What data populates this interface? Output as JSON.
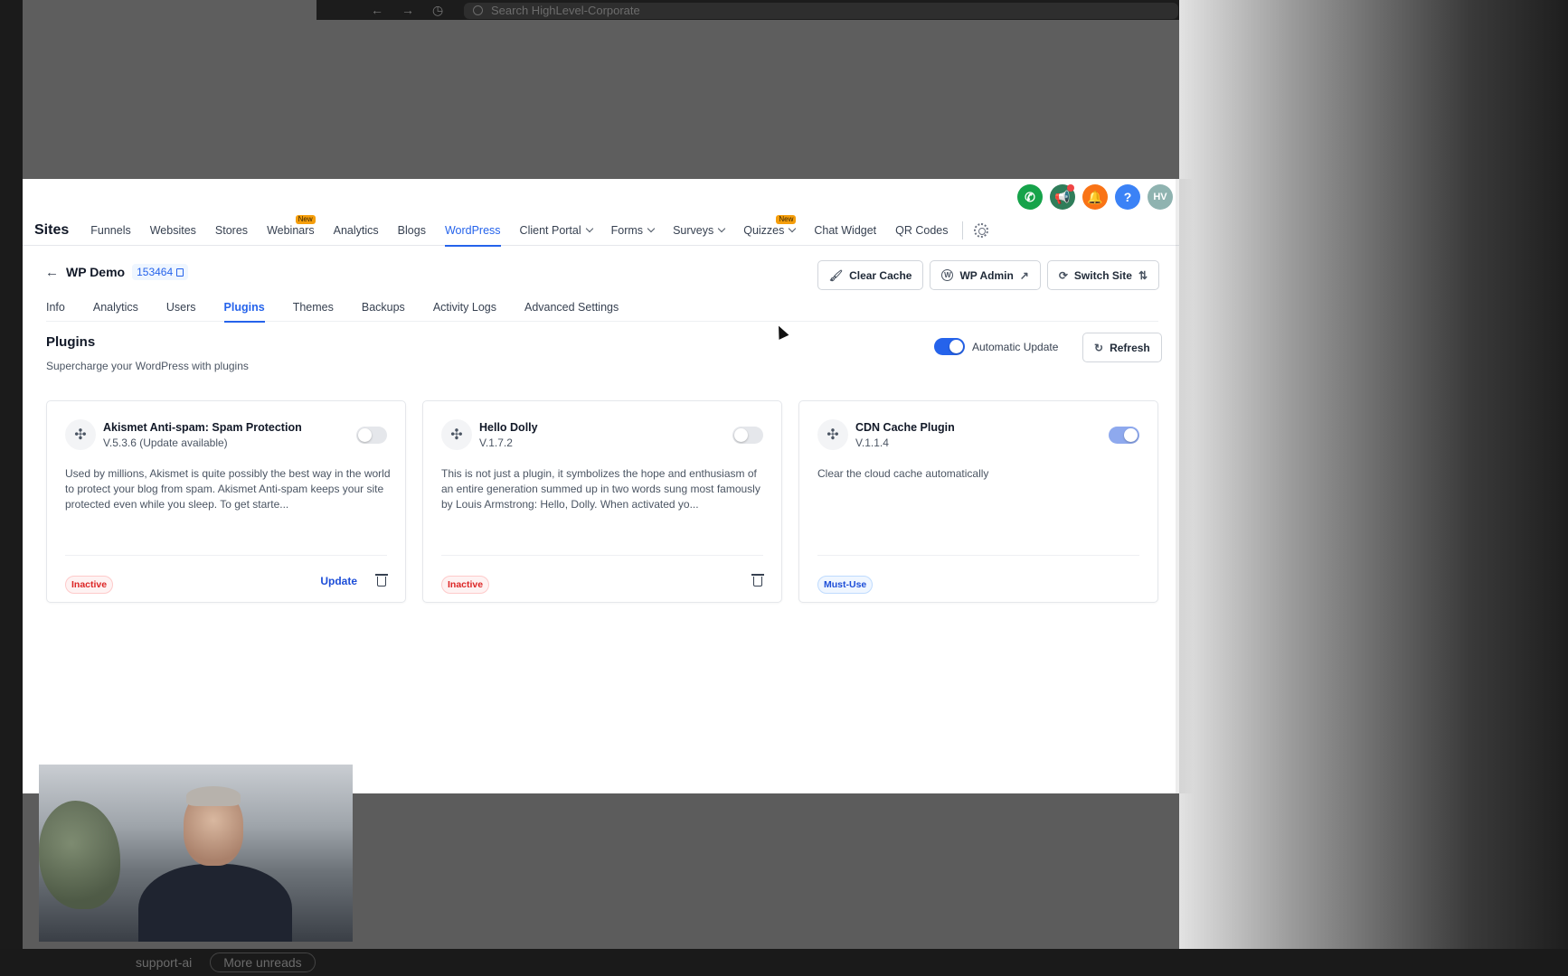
{
  "browser": {
    "search_placeholder": "Search HighLevel-Corporate"
  },
  "taskbar": {
    "channel": "support-ai",
    "more_unreads": "More unreads"
  },
  "header_icons": {
    "avatar_initials": "HV",
    "help_glyph": "?"
  },
  "topnav": {
    "brand": "Sites",
    "items": [
      {
        "label": "Funnels"
      },
      {
        "label": "Websites"
      },
      {
        "label": "Stores"
      },
      {
        "label": "Webinars",
        "badge": "New"
      },
      {
        "label": "Analytics"
      },
      {
        "label": "Blogs"
      },
      {
        "label": "WordPress",
        "active": true
      },
      {
        "label": "Client Portal",
        "dropdown": true
      },
      {
        "label": "Forms",
        "dropdown": true
      },
      {
        "label": "Surveys",
        "dropdown": true
      },
      {
        "label": "Quizzes",
        "dropdown": true,
        "badge": "New"
      },
      {
        "label": "Chat Widget"
      },
      {
        "label": "QR Codes"
      }
    ]
  },
  "site": {
    "back_glyph": "←",
    "name": "WP Demo",
    "id": "153464",
    "actions": {
      "clear_cache": "Clear Cache",
      "wp_admin": "WP Admin",
      "switch_site": "Switch Site"
    }
  },
  "subtabs": [
    {
      "label": "Info"
    },
    {
      "label": "Analytics"
    },
    {
      "label": "Users"
    },
    {
      "label": "Plugins",
      "active": true
    },
    {
      "label": "Themes"
    },
    {
      "label": "Backups"
    },
    {
      "label": "Activity Logs"
    },
    {
      "label": "Advanced Settings"
    }
  ],
  "plugins_section": {
    "title": "Plugins",
    "subtitle": "Supercharge your WordPress with plugins",
    "automatic_update_label": "Automatic Update",
    "automatic_update_on": true,
    "refresh_label": "Refresh"
  },
  "plugins": [
    {
      "name": "Akismet Anti-spam: Spam Protection",
      "version": "V.5.3.6 (Update available)",
      "enabled": false,
      "description": "Used by millions, Akismet is quite possibly the best way in the world to protect your blog from spam. Akismet Anti-spam keeps your site protected even while you sleep. To get starte...",
      "status": "Inactive",
      "update_label": "Update"
    },
    {
      "name": "Hello Dolly",
      "version": "V.1.7.2",
      "enabled": false,
      "description": "This is not just a plugin, it symbolizes the hope and enthusiasm of an entire generation summed up in two words sung most famously by Louis Armstrong: Hello, Dolly. When activated yo...",
      "status": "Inactive"
    },
    {
      "name": "CDN Cache Plugin",
      "version": "V.1.1.4",
      "enabled": true,
      "description": "Clear the cloud cache automatically",
      "status": "Must-Use"
    }
  ],
  "colors": {
    "accent": "#2563eb",
    "inactive_badge": "#dc2626",
    "mustuse_badge": "#1d4ed8",
    "new_badge": "#f59e0b"
  }
}
